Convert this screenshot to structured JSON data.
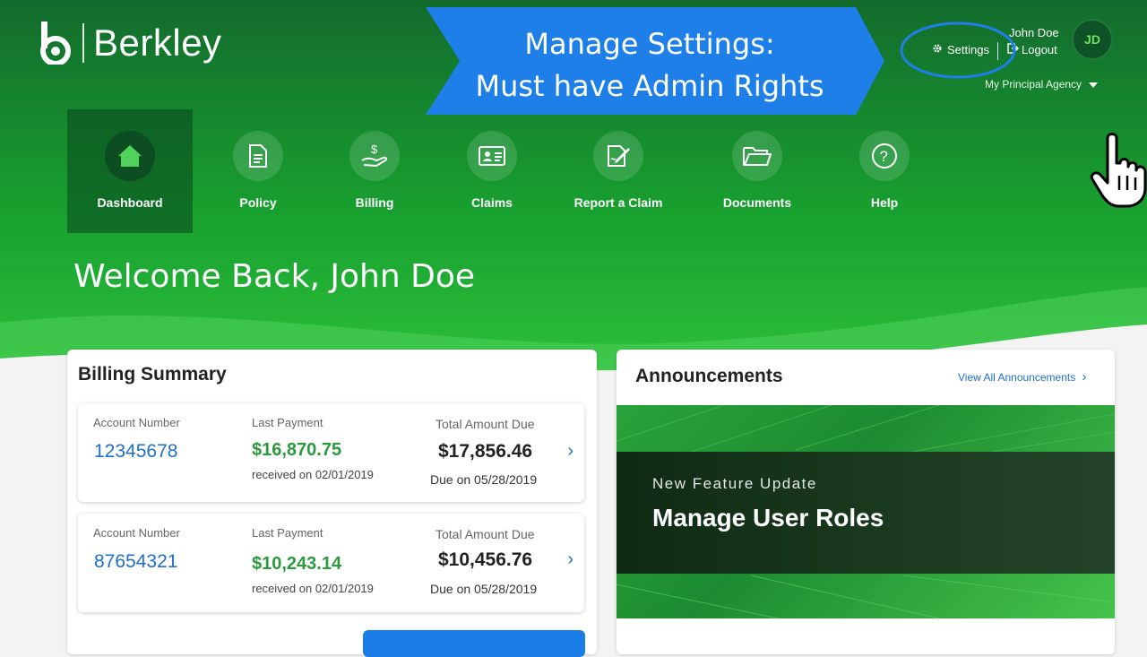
{
  "brand": {
    "name": "Berkley"
  },
  "banner": {
    "line1": "Manage Settings:",
    "line2": "Must have Admin Rights"
  },
  "header": {
    "user_name": "John Doe",
    "settings_label": "Settings",
    "logout_label": "Logout",
    "avatar_initials": "JD",
    "agency_label": "My Principal Agency"
  },
  "nav": {
    "items": [
      {
        "label": "Dashboard",
        "icon": "home-icon",
        "active": true
      },
      {
        "label": "Policy",
        "icon": "document-icon"
      },
      {
        "label": "Billing",
        "icon": "dollar-hand-icon"
      },
      {
        "label": "Claims",
        "icon": "id-card-icon"
      },
      {
        "label": "Report a Claim",
        "icon": "edit-document-icon"
      },
      {
        "label": "Documents",
        "icon": "folder-icon"
      },
      {
        "label": "Help",
        "icon": "help-icon"
      }
    ]
  },
  "welcome": "Welcome Back, John Doe",
  "billing": {
    "title": "Billing Summary",
    "account_label": "Account Number",
    "last_payment_label": "Last Payment",
    "total_due_label": "Total Amount Due",
    "rows": [
      {
        "account": "12345678",
        "last_payment": "$16,870.75",
        "received": "received on 02/01/2019",
        "total_due": "$17,856.46",
        "due_on": "Due on 05/28/2019"
      },
      {
        "account": "87654321",
        "last_payment": "$10,243.14",
        "received": "received on 02/01/2019",
        "total_due": "$10,456.76",
        "due_on": "Due on 05/28/2019"
      }
    ]
  },
  "announcements": {
    "title": "Announcements",
    "view_all": "View All Announcements",
    "feature_sub": "New Feature Update",
    "feature_title": "Manage User Roles"
  },
  "colors": {
    "brand_green": "#18a02f",
    "link_blue": "#1e6fd0",
    "callout_blue": "#1e7fe8"
  }
}
